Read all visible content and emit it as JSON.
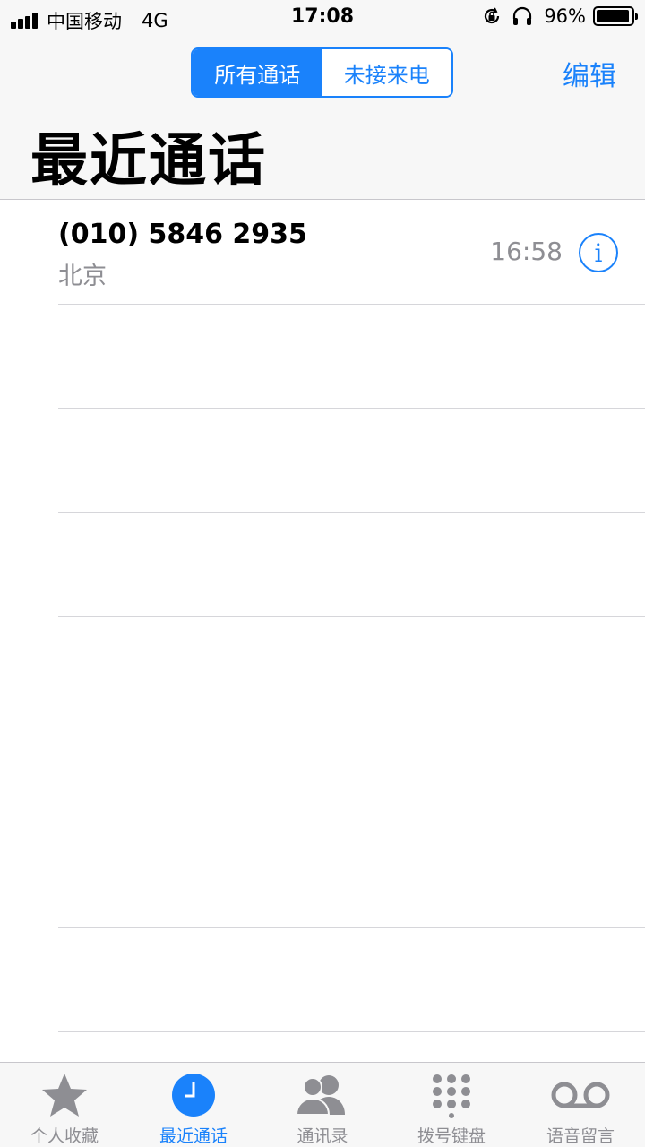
{
  "status_bar": {
    "carrier": "中国移动",
    "network": "4G",
    "time": "17:08",
    "battery_percent": "96%",
    "battery_level": 0.96,
    "icons": [
      "signal-icon",
      "rotation-lock-icon",
      "headphones-icon",
      "battery-icon"
    ]
  },
  "header": {
    "segments": {
      "all_calls": "所有通话",
      "missed": "未接来电"
    },
    "selected_segment": "all_calls",
    "edit_label": "编辑",
    "title": "最近通话"
  },
  "calls": [
    {
      "number": "(010) 5846 2935",
      "location": "北京",
      "time": "16:58",
      "info_icon": "i"
    }
  ],
  "tab_bar": {
    "tabs": [
      {
        "label": "个人收藏",
        "icon": "star-icon"
      },
      {
        "label": "最近通话",
        "icon": "clock-icon",
        "active": true
      },
      {
        "label": "通讯录",
        "icon": "contacts-icon"
      },
      {
        "label": "拨号键盘",
        "icon": "keypad-icon"
      },
      {
        "label": "语音留言",
        "icon": "voicemail-icon"
      }
    ]
  },
  "colors": {
    "accent": "#1a82fb",
    "secondary_text": "#8e8e93",
    "bar_background": "#f7f7f7"
  }
}
